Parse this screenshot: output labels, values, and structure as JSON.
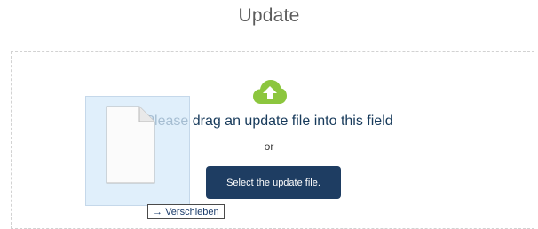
{
  "page": {
    "title": "Update"
  },
  "dropzone": {
    "instruction": "Please drag an update file into this field",
    "or_text": "or",
    "select_button_label": "Select the update file.",
    "icon": "cloud-upload-icon",
    "icon_color": "#8cc63e"
  },
  "drag": {
    "tooltip_arrow": "→",
    "tooltip_label": "Verschieben",
    "ghost_icon": "file-icon"
  },
  "colors": {
    "button_background": "#1e3d62",
    "instruction_text": "#173a5b",
    "ghost_overlay": "#d6e9fa"
  }
}
